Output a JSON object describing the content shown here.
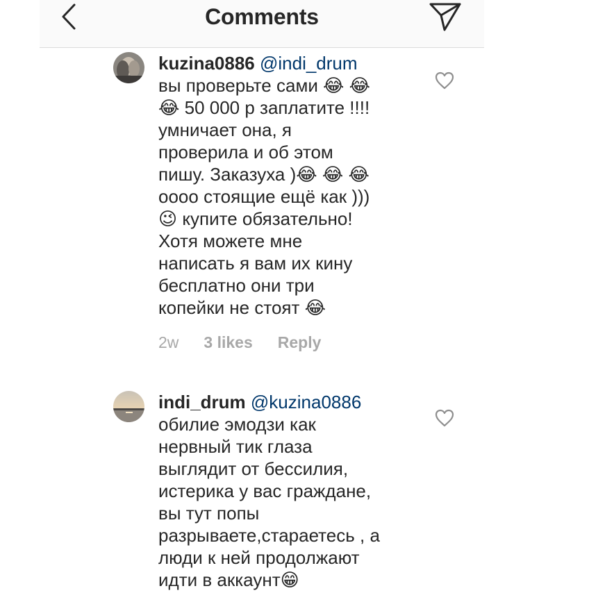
{
  "header": {
    "title": "Comments",
    "back_icon": "chevron-left-icon",
    "send_icon": "paper-plane-icon"
  },
  "comments": [
    {
      "username": "kuzina0886",
      "mention": "@indi_drum",
      "text": "вы проверьте сами 😂 😂\n😂 50 000 р заплатите !!!!\nумничает она, я\nпроверила и об этом\nпишу. Заказуха )😂 😂 😂\noooo стоящие ещё как )))\n😉 купите обязательно!\nХотя можете мне\nнаписать я вам их кину\nбесплатно они три\nкопейки не стоят 😂",
      "time": "2w",
      "likes": "3 likes",
      "reply": "Reply"
    },
    {
      "username": "indi_drum",
      "mention": "@kuzina0886",
      "text": "обилие эмодзи как\nнервный тик глаза\nвыглядит от бессилия,\nистерика у вас граждане,\nвы тут попы\nразрываете,стараетесь , а\nлюди к ней продолжают\nидти в аккаунт😁"
    }
  ],
  "colors": {
    "text": "#262626",
    "mention": "#00376b",
    "meta": "#a8a8a8",
    "header_bg": "#fafafa"
  }
}
